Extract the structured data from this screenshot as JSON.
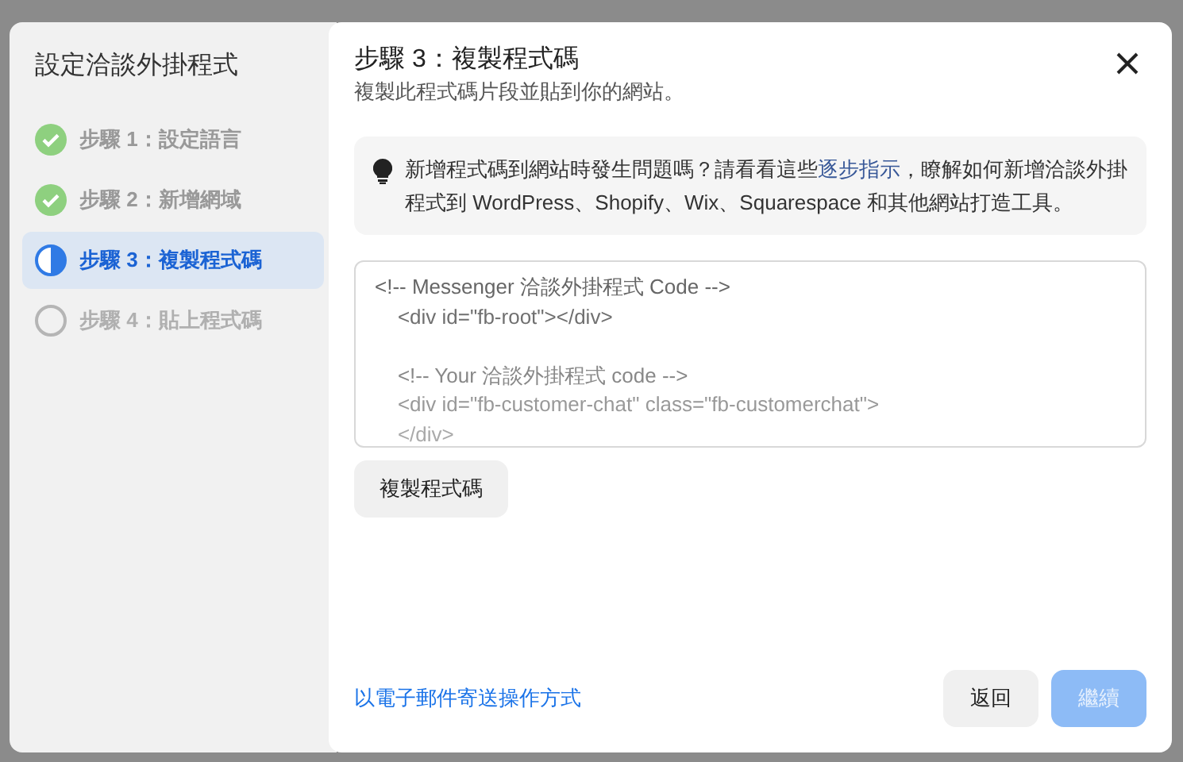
{
  "sidebar": {
    "title": "設定洽談外掛程式",
    "steps": [
      {
        "label": "步驟 1：設定語言",
        "kind": "done",
        "selected": false
      },
      {
        "label": "步驟 2：新增網域",
        "kind": "done",
        "selected": false
      },
      {
        "label": "步驟 3：複製程式碼",
        "kind": "current",
        "selected": true
      },
      {
        "label": "步驟 4：貼上程式碼",
        "kind": "pending",
        "selected": false
      }
    ]
  },
  "dialog": {
    "title": "步驟 3：複製程式碼",
    "subtitle": "複製此程式碼片段並貼到你的網站。",
    "tip": {
      "before": "新增程式碼到網站時發生問題嗎？請看看這些",
      "link": "逐步指示",
      "after": "，瞭解如何新增洽談外掛程式到 WordPress、Shopify、Wix、Squarespace 和其他網站打造工具。"
    },
    "code_lines": [
      {
        "text": "<!-- Messenger 洽談外掛程式 Code -->",
        "blank_before": false
      },
      {
        "text": "    <div id=\"fb-root\"></div>",
        "blank_before": false
      },
      {
        "text": "    <!-- Your 洽談外掛程式 code -->",
        "blank_before": true
      },
      {
        "text": "    <div id=\"fb-customer-chat\" class=\"fb-customerchat\">",
        "blank_before": false
      },
      {
        "text": "    </div>",
        "blank_before": false
      }
    ],
    "copy_button": "複製程式碼",
    "email_link": "以電子郵件寄送操作方式",
    "buttons": [
      {
        "label": "返回",
        "kind": "secondary",
        "disabled": false
      },
      {
        "label": "繼續",
        "kind": "primary",
        "disabled": true
      }
    ]
  }
}
